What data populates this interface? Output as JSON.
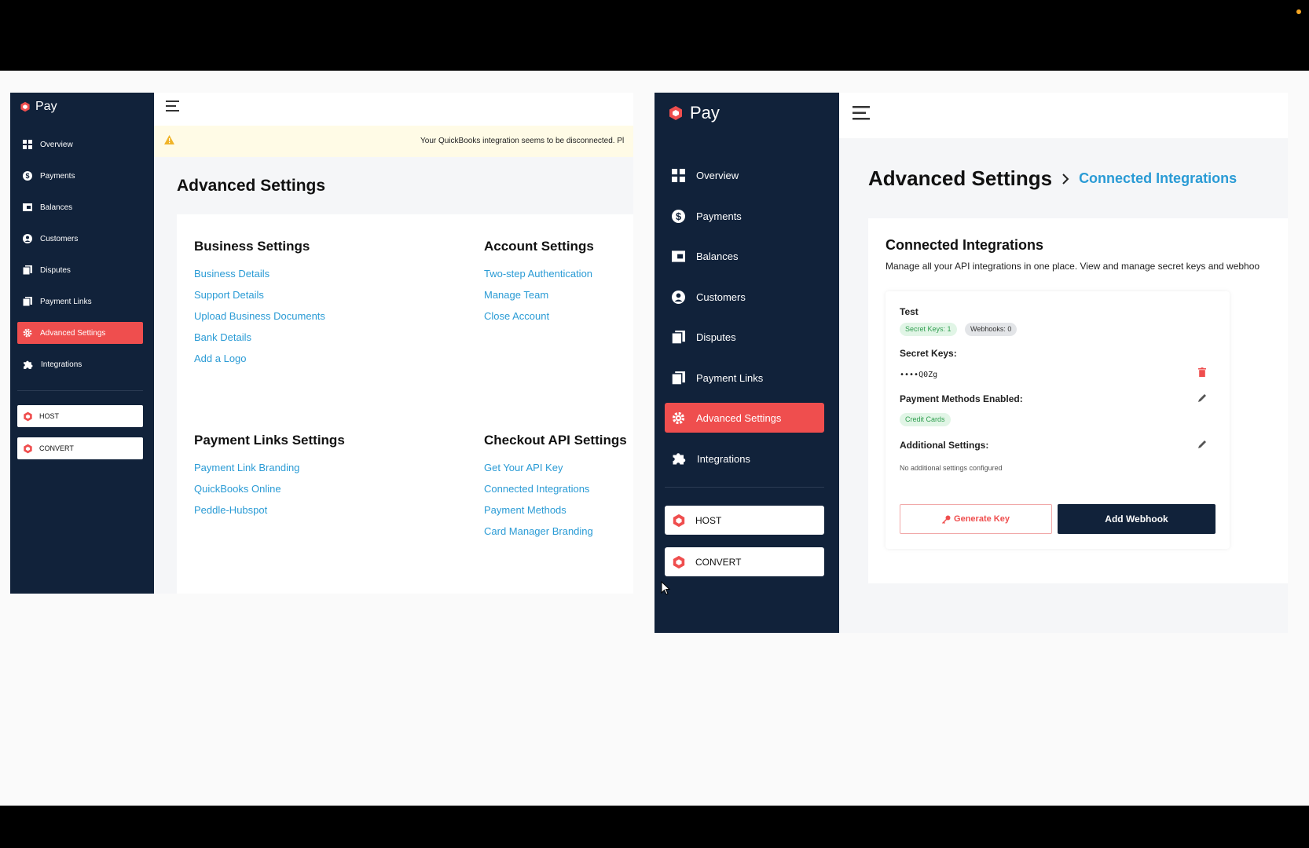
{
  "left_app": {
    "brand": "Pay",
    "nav": [
      {
        "label": "Overview"
      },
      {
        "label": "Payments"
      },
      {
        "label": "Balances"
      },
      {
        "label": "Customers"
      },
      {
        "label": "Disputes"
      },
      {
        "label": "Payment Links"
      },
      {
        "label": "Advanced Settings",
        "active": true
      },
      {
        "label": "Integrations"
      }
    ],
    "products": [
      {
        "label": "HOST"
      },
      {
        "label": "CONVERT"
      }
    ],
    "alert": "Your QuickBooks integration seems to be disconnected. Pl",
    "page_title": "Advanced Settings",
    "sections": [
      {
        "title": "Business Settings",
        "links": [
          "Business Details",
          "Support Details",
          "Upload Business Documents",
          "Bank Details",
          "Add a Logo"
        ]
      },
      {
        "title": "Account Settings",
        "links": [
          "Two-step Authentication",
          "Manage Team",
          "Close Account"
        ]
      },
      {
        "title": "Payment Links Settings",
        "links": [
          "Payment Link Branding",
          "QuickBooks Online",
          "Peddle-Hubspot"
        ]
      },
      {
        "title": "Checkout API Settings",
        "links": [
          "Get Your API Key",
          "Connected Integrations",
          "Payment Methods",
          "Card Manager Branding"
        ]
      }
    ]
  },
  "right_app": {
    "brand": "Pay",
    "nav": [
      {
        "label": "Overview"
      },
      {
        "label": "Payments"
      },
      {
        "label": "Balances"
      },
      {
        "label": "Customers"
      },
      {
        "label": "Disputes"
      },
      {
        "label": "Payment Links"
      },
      {
        "label": "Advanced Settings",
        "active": true
      },
      {
        "label": "Integrations"
      }
    ],
    "products": [
      {
        "label": "HOST"
      },
      {
        "label": "CONVERT"
      }
    ],
    "breadcrumb": {
      "parent": "Advanced Settings",
      "current": "Connected Integrations"
    },
    "card": {
      "title": "Connected Integrations",
      "description": "Manage all your API integrations in one place. View and manage secret keys and webhoo",
      "integration": {
        "name": "Test",
        "badge_keys": "Secret Keys: 1",
        "badge_webhooks": "Webhooks: 0",
        "secret_keys_label": "Secret Keys:",
        "secret_key_value": "••••Q0Zg",
        "payment_methods_label": "Payment Methods Enabled:",
        "payment_method_badge": "Credit Cards",
        "additional_label": "Additional Settings:",
        "additional_value": "No additional settings configured",
        "generate_key": "Generate Key",
        "add_webhook": "Add Webhook"
      }
    }
  },
  "colors": {
    "sidebar": "#11223a",
    "accent": "#ef4e4e",
    "link": "#2a9bd5",
    "alert_bg": "#fffbe6"
  }
}
